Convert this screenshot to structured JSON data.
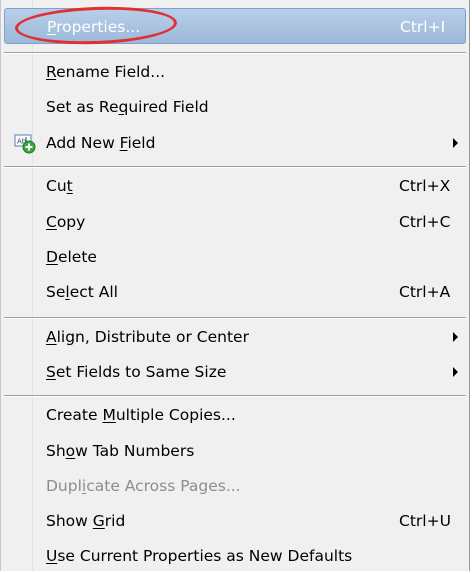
{
  "menu": {
    "items": [
      {
        "pre": "",
        "u": "P",
        "post": "roperties...",
        "shortcut": "Ctrl+I"
      },
      {
        "pre": "",
        "u": "R",
        "post": "ename Field...",
        "shortcut": ""
      },
      {
        "pre": "Set as Re",
        "u": "q",
        "post": "uired Field",
        "shortcut": ""
      },
      {
        "pre": "Add New ",
        "u": "F",
        "post": "ield",
        "shortcut": ""
      },
      {
        "pre": "Cu",
        "u": "t",
        "post": "",
        "shortcut": "Ctrl+X"
      },
      {
        "pre": "",
        "u": "C",
        "post": "opy",
        "shortcut": "Ctrl+C"
      },
      {
        "pre": "",
        "u": "D",
        "post": "elete",
        "shortcut": ""
      },
      {
        "pre": "Se",
        "u": "l",
        "post": "ect All",
        "shortcut": "Ctrl+A"
      },
      {
        "pre": "",
        "u": "A",
        "post": "lign, Distribute or Center",
        "shortcut": ""
      },
      {
        "pre": "",
        "u": "S",
        "post": "et Fields to Same Size",
        "shortcut": ""
      },
      {
        "pre": "Create ",
        "u": "M",
        "post": "ultiple Copies...",
        "shortcut": ""
      },
      {
        "pre": "Sh",
        "u": "o",
        "post": "w Tab Numbers",
        "shortcut": ""
      },
      {
        "pre": "Dupl",
        "u": "i",
        "post": "cate Across Pages...",
        "shortcut": ""
      },
      {
        "pre": "Show ",
        "u": "G",
        "post": "rid",
        "shortcut": "Ctrl+U"
      },
      {
        "pre": "",
        "u": "U",
        "post": "se Current Properties as New Defaults",
        "shortcut": ""
      }
    ],
    "icons": {
      "add_new_field": "text-field-add-icon",
      "submenu": "chevron-right-icon"
    },
    "colors": {
      "highlight": "#a9c4e6",
      "annotation": "#e03030",
      "disabled_text": "#8d8d8d"
    }
  }
}
